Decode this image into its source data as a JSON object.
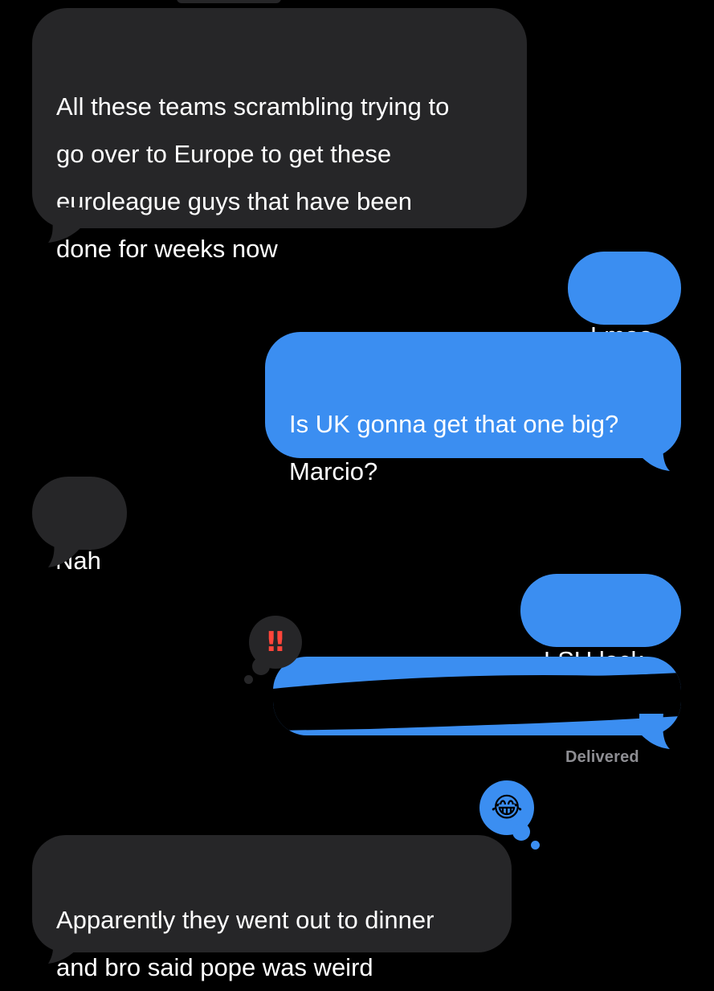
{
  "colors": {
    "background": "#000000",
    "received_bubble": "#262628",
    "sent_bubble": "#3b8ef1",
    "text": "#ffffff",
    "status": "#8e8e93",
    "redaction": "#000000"
  },
  "messages": [
    {
      "id": "m1",
      "direction": "received",
      "text": "All these teams scrambling trying to\ngo over to Europe to get these\neuroleague guys that have been\ndone for weeks now"
    },
    {
      "id": "m2",
      "direction": "sent",
      "text": "Lmao"
    },
    {
      "id": "m3",
      "direction": "sent",
      "text": "Is UK gonna get that one big?\nMarcio?"
    },
    {
      "id": "m4",
      "direction": "received",
      "text": "Nah"
    },
    {
      "id": "m5",
      "direction": "sent",
      "text": "LSU lock"
    },
    {
      "id": "m6",
      "direction": "sent",
      "text": "",
      "redacted": true,
      "reaction": {
        "icon": "double-exclamation-icon",
        "glyph": "‼"
      }
    },
    {
      "id": "m7",
      "direction": "received",
      "text": "Apparently they went out to dinner\nand bro said pope was weird",
      "reaction": {
        "icon": "laughing-emoji-icon",
        "glyph": "😂"
      }
    }
  ],
  "status": {
    "delivered_label": "Delivered"
  }
}
